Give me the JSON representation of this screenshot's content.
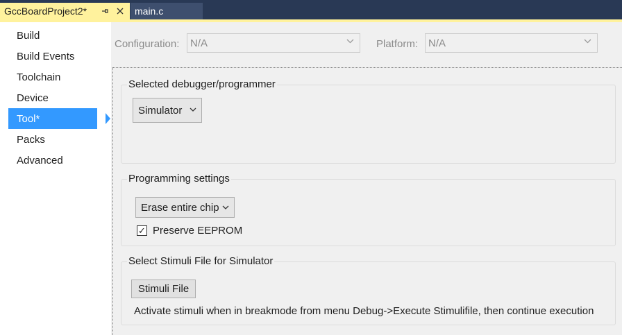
{
  "tabs": {
    "active_label": "GccBoardProject2*",
    "inactive_label": "main.c"
  },
  "nav": {
    "items": [
      {
        "label": "Build"
      },
      {
        "label": "Build Events"
      },
      {
        "label": "Toolchain"
      },
      {
        "label": "Device"
      },
      {
        "label": "Tool*"
      },
      {
        "label": "Packs"
      },
      {
        "label": "Advanced"
      }
    ],
    "selected": "Tool*"
  },
  "config": {
    "configuration_label": "Configuration:",
    "configuration_value": "N/A",
    "platform_label": "Platform:",
    "platform_value": "N/A"
  },
  "debugger_group": {
    "title": "Selected debugger/programmer",
    "selected_tool": "Simulator"
  },
  "programming_group": {
    "title": "Programming settings",
    "erase_option": "Erase entire chip",
    "preserve_eeprom_label": "Preserve EEPROM",
    "preserve_eeprom_checked": true,
    "check_glyph": "✓"
  },
  "stimuli_group": {
    "title": "Select Stimuli File for Simulator",
    "button_label": "Stimuli File",
    "info": "Activate stimuli when in breakmode from menu Debug->Execute Stimulifile, then continue execution"
  },
  "colors": {
    "tab_active": "#fff29d",
    "tabstrip": "#293955",
    "nav_selected": "#3399ff"
  }
}
